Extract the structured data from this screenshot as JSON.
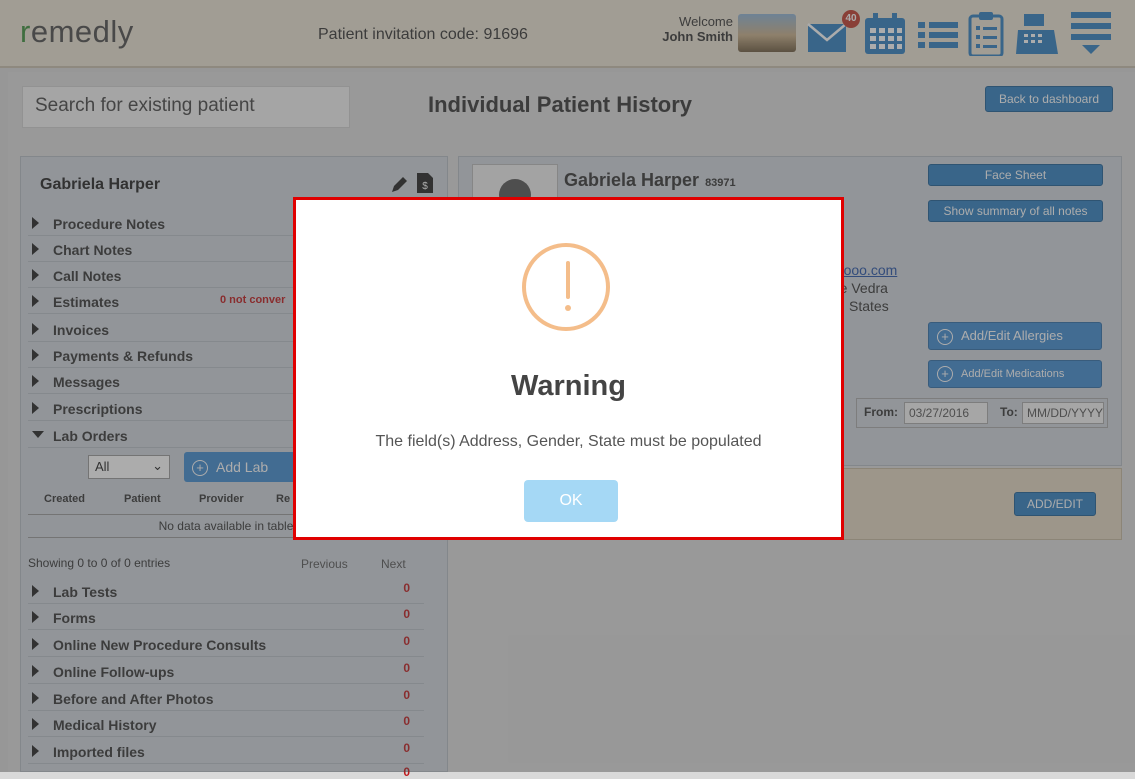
{
  "app": {
    "logo_r": "r",
    "logo_rest": "emedly",
    "invitation": "Patient invitation code: 91696",
    "welcome": "Welcome",
    "user": "John Smith",
    "message_count": "40"
  },
  "header": {
    "search_placeholder": "Search for existing patient",
    "title": "Individual Patient History",
    "back_button": "Back to dashboard"
  },
  "sidebar": {
    "patient_name": "Gabriela Harper",
    "items": [
      {
        "label": "Procedure Notes",
        "count": "",
        "note": ""
      },
      {
        "label": "Chart Notes",
        "count": "",
        "note": ""
      },
      {
        "label": "Call Notes",
        "count": "",
        "note": ""
      },
      {
        "label": "Estimates",
        "count": "",
        "note": "0 not conver"
      },
      {
        "label": "Invoices",
        "count": "",
        "note": ""
      },
      {
        "label": "Payments & Refunds",
        "count": "",
        "note": ""
      },
      {
        "label": "Messages",
        "count": "",
        "note": ""
      },
      {
        "label": "Prescriptions",
        "count": "",
        "note": ""
      },
      {
        "label": "Lab Orders",
        "count": "",
        "note": ""
      }
    ],
    "lab_orders": {
      "filter_value": "All",
      "add_button": "Add Lab",
      "columns": [
        "Created",
        "Patient",
        "Provider",
        "Re"
      ],
      "empty": "No data available in table",
      "showing": "Showing 0 to 0 of 0 entries",
      "previous": "Previous",
      "next": "Next"
    },
    "items2": [
      {
        "label": "Lab Tests",
        "count": "0"
      },
      {
        "label": "Forms",
        "count": "0"
      },
      {
        "label": "Online New Procedure Consults",
        "count": "0"
      },
      {
        "label": "Online Follow-ups",
        "count": "0"
      },
      {
        "label": "Before and After Photos",
        "count": "0"
      },
      {
        "label": "Medical History",
        "count": "0"
      },
      {
        "label": "Imported files",
        "count": "0"
      }
    ],
    "last_count": "0"
  },
  "patient": {
    "name": "Gabriela Harper",
    "id": "83971",
    "email_partial": "ahooo.com",
    "city_partial": "nte Vedra",
    "country_partial": "States",
    "face_sheet": "Face Sheet",
    "show_summary": "Show summary of all notes",
    "allergies_button": "Add/Edit Allergies",
    "medications_button": "Add/Edit Medications",
    "from_label": "From:",
    "from_value": "03/27/2016",
    "to_label": "To:",
    "to_placeholder": "MM/DD/YYYY",
    "add_edit": "ADD/EDIT"
  },
  "modal": {
    "title": "Warning",
    "message": "The field(s) Address, Gender, State must be populated",
    "ok": "OK"
  },
  "colors": {
    "accent": "#2e7fc0",
    "warning": "#f4bd8a",
    "modal_border": "#e00000",
    "count_red": "#c0181b"
  }
}
